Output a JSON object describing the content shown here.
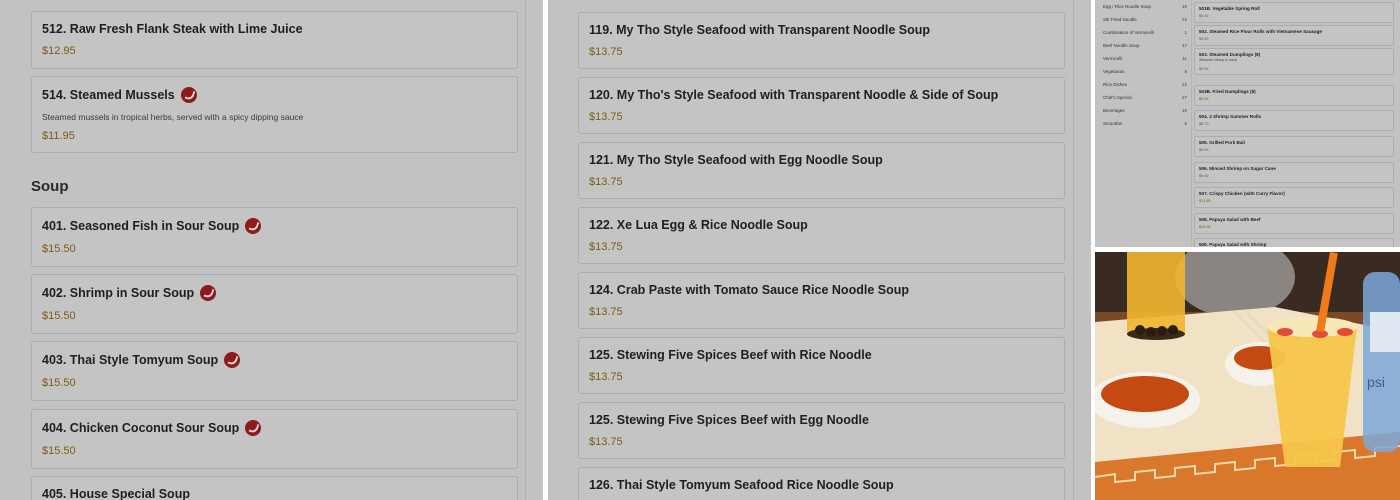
{
  "left": {
    "top_items": [
      {
        "name": "512. Raw Fresh Flank Steak with Lime Juice",
        "desc": "",
        "price": "$12.95",
        "spicy": false
      },
      {
        "name": "514. Steamed Mussels",
        "desc": "Steamed mussels in tropical herbs, served with a spicy dipping sauce",
        "price": "$11.95",
        "spicy": true
      }
    ],
    "section_title": "Soup",
    "soup_items": [
      {
        "name": "401. Seasoned Fish in Sour Soup",
        "price": "$15.50",
        "spicy": true
      },
      {
        "name": "402. Shrimp in Sour Soup",
        "price": "$15.50",
        "spicy": true
      },
      {
        "name": "403. Thai Style Tomyum Soup",
        "price": "$15.50",
        "spicy": true
      },
      {
        "name": "404. Chicken Coconut Sour Soup",
        "price": "$15.50",
        "spicy": true
      },
      {
        "name": "405. House Special Soup",
        "price": "",
        "spicy": false
      }
    ]
  },
  "middle": {
    "items": [
      {
        "name": "119. My Tho Style Seafood with Transparent Noodle Soup",
        "price": "$13.75"
      },
      {
        "name": "120. My Tho's Style Seafood with Transparent Noodle & Side of Soup",
        "price": "$13.75"
      },
      {
        "name": "121. My Tho Style Seafood with Egg Noodle Soup",
        "price": "$13.75"
      },
      {
        "name": "122. Xe Lua Egg & Rice Noodle Soup",
        "price": "$13.75"
      },
      {
        "name": "124. Crab Paste with Tomato Sauce Rice Noodle Soup",
        "price": "$13.75"
      },
      {
        "name": "125. Stewing Five Spices Beef with Rice Noodle",
        "price": "$13.75"
      },
      {
        "name": "125. Stewing Five Spices Beef with Egg Noodle",
        "price": "$13.75"
      },
      {
        "name": "126. Thai Style Tomyum Seafood Rice Noodle Soup",
        "price": ""
      }
    ]
  },
  "right_top": {
    "categories": [
      {
        "label": "Egg / Rice Noodle Soup",
        "count": "19"
      },
      {
        "label": "Stir Fried Noodle",
        "count": "22"
      },
      {
        "label": "Combination of Vermicelli",
        "count": "1"
      },
      {
        "label": "Beef Noodle Soup",
        "count": "17"
      },
      {
        "label": "Vermicelli",
        "count": "11"
      },
      {
        "label": "Vegetarian",
        "count": "8"
      },
      {
        "label": "Rice Dishes",
        "count": "22"
      },
      {
        "label": "Chef's Special",
        "count": "27"
      },
      {
        "label": "Beverages",
        "count": "19"
      },
      {
        "label": "Smoothie",
        "count": "8"
      }
    ],
    "items": [
      {
        "name": "501B. Vegetable Spring Roll",
        "desc": "",
        "price": "$5.45"
      },
      {
        "name": "502. Steamed Rice Flour Rolls with Vietnamese Sausage",
        "desc": "",
        "price": "$9.95"
      },
      {
        "name": "503. Steamed Dumplings (8)",
        "desc": "Steamed shrimp & meat",
        "price": "$9.95"
      },
      {
        "name": "503B. Fried Dumplings (8)",
        "desc": "",
        "price": "$9.95"
      },
      {
        "name": "504. 2 Shrimp Summer Rolls",
        "desc": "",
        "price": "$6.70"
      },
      {
        "name": "505. Grilled Pork Bali",
        "desc": "",
        "price": "$9.95"
      },
      {
        "name": "506. Minced Shrimp on Sugar Cane",
        "desc": "",
        "price": "$9.45"
      },
      {
        "name": "507. Crispy Chicken (with Curry Flavor)",
        "desc": "",
        "price": "$11.95"
      },
      {
        "name": "508. Papaya Salad with Beef",
        "desc": "",
        "price": "$10.95"
      },
      {
        "name": "509. Papaya Salad with Shrimp",
        "desc": "",
        "price": ""
      }
    ]
  },
  "photo": {
    "brand_text": "psi"
  },
  "colors": {
    "panel_bg": "#c2c2c2",
    "price": "#7a5a18",
    "spicy_badge": "#8e1b1b"
  }
}
